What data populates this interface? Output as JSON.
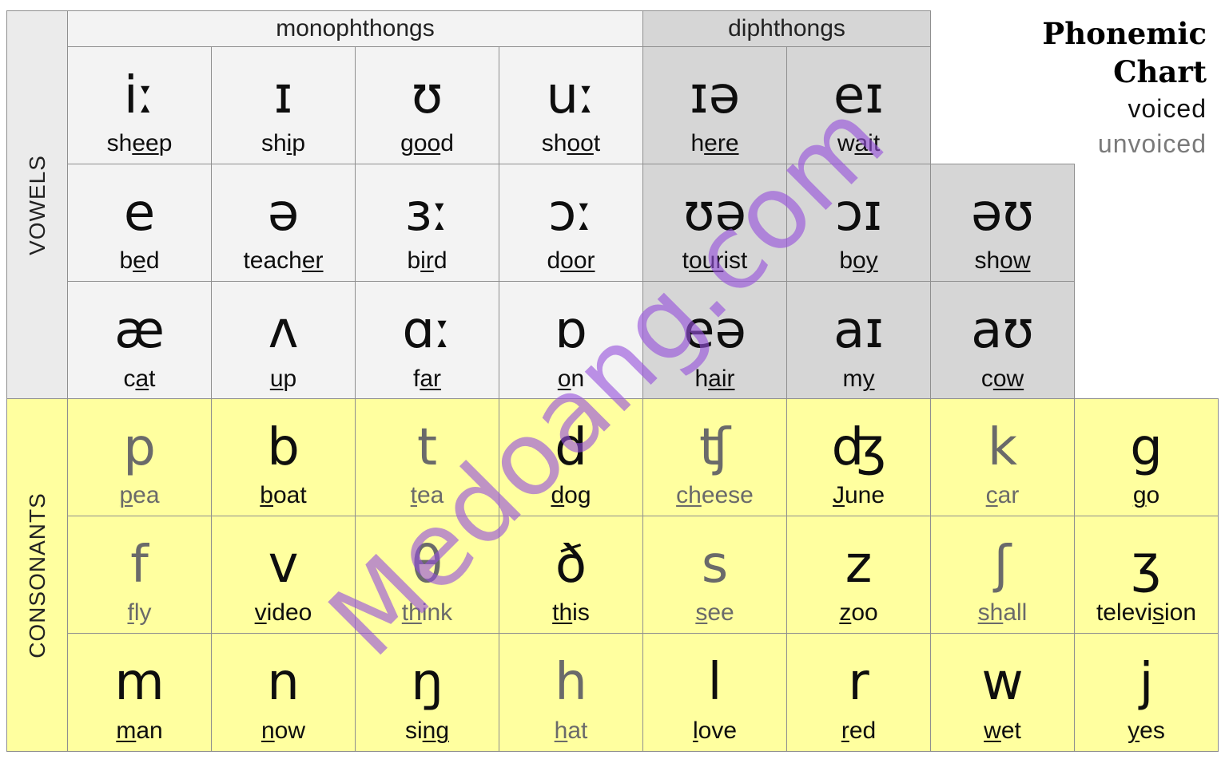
{
  "title": {
    "line1": "Phonemic",
    "line2": "Chart"
  },
  "legend": {
    "voiced": "voiced",
    "unvoiced": "unvoiced"
  },
  "headers": {
    "monophthongs": "monophthongs",
    "diphthongs": "diphthongs"
  },
  "side_labels": {
    "vowels": "VOWELS",
    "consonants": "CONSONANTS"
  },
  "watermark": "Medoang.com",
  "colors": {
    "monophthong_bg": "#f3f3f3",
    "diphthong_bg": "#d6d6d6",
    "consonant_bg": "#ffff9f",
    "voiced_text": "#0e0e0e",
    "unvoiced_text": "#6a6a6a",
    "watermark": "#9650dc"
  },
  "vowels": [
    [
      {
        "symbol": "iː",
        "pre": "sh",
        "u": "ee",
        "post": "p",
        "type": "mono"
      },
      {
        "symbol": "ɪ",
        "pre": "sh",
        "u": "i",
        "post": "p",
        "type": "mono"
      },
      {
        "symbol": "ʊ",
        "pre": "g",
        "u": "oo",
        "post": "d",
        "type": "mono"
      },
      {
        "symbol": "uː",
        "pre": "sh",
        "u": "oo",
        "post": "t",
        "type": "mono"
      },
      {
        "symbol": "ɪə",
        "pre": "h",
        "u": "ere",
        "post": "",
        "type": "diph"
      },
      {
        "symbol": "eɪ",
        "pre": "w",
        "u": "ai",
        "post": "t",
        "type": "diph"
      }
    ],
    [
      {
        "symbol": "e",
        "pre": "b",
        "u": "e",
        "post": "d",
        "type": "mono"
      },
      {
        "symbol": "ə",
        "pre": "teach",
        "u": "er",
        "post": "",
        "type": "mono"
      },
      {
        "symbol": "ɜː",
        "pre": "b",
        "u": "ir",
        "post": "d",
        "type": "mono"
      },
      {
        "symbol": "ɔː",
        "pre": "d",
        "u": "oor",
        "post": "",
        "type": "mono"
      },
      {
        "symbol": "ʊə",
        "pre": "t",
        "u": "our",
        "post": "ist",
        "type": "diph"
      },
      {
        "symbol": "ɔɪ",
        "pre": "b",
        "u": "oy",
        "post": "",
        "type": "diph"
      },
      {
        "symbol": "əʊ",
        "pre": "sh",
        "u": "ow",
        "post": "",
        "type": "diph"
      }
    ],
    [
      {
        "symbol": "æ",
        "pre": "c",
        "u": "a",
        "post": "t",
        "type": "mono"
      },
      {
        "symbol": "ʌ",
        "pre": "",
        "u": "u",
        "post": "p",
        "type": "mono"
      },
      {
        "symbol": "ɑː",
        "pre": "f",
        "u": "ar",
        "post": "",
        "type": "mono"
      },
      {
        "symbol": "ɒ",
        "pre": "",
        "u": "o",
        "post": "n",
        "type": "mono"
      },
      {
        "symbol": "eə",
        "pre": "h",
        "u": "air",
        "post": "",
        "type": "diph"
      },
      {
        "symbol": "aɪ",
        "pre": "m",
        "u": "y",
        "post": "",
        "type": "diph"
      },
      {
        "symbol": "aʊ",
        "pre": "c",
        "u": "ow",
        "post": "",
        "type": "diph"
      }
    ]
  ],
  "consonants": [
    [
      {
        "symbol": "p",
        "pre": "",
        "u": "p",
        "post": "ea",
        "voice": "unvoiced"
      },
      {
        "symbol": "b",
        "pre": "",
        "u": "b",
        "post": "oat",
        "voice": "voiced"
      },
      {
        "symbol": "t",
        "pre": "",
        "u": "t",
        "post": "ea",
        "voice": "unvoiced"
      },
      {
        "symbol": "d",
        "pre": "",
        "u": "d",
        "post": "og",
        "voice": "voiced"
      },
      {
        "symbol": "ʧ",
        "pre": "",
        "u": "ch",
        "post": "eese",
        "voice": "unvoiced"
      },
      {
        "symbol": "ʤ",
        "pre": "",
        "u": "J",
        "post": "une",
        "voice": "voiced"
      },
      {
        "symbol": "k",
        "pre": "",
        "u": "c",
        "post": "ar",
        "voice": "unvoiced"
      },
      {
        "symbol": "g",
        "pre": "",
        "u": "g",
        "post": "o",
        "voice": "voiced"
      }
    ],
    [
      {
        "symbol": "f",
        "pre": "",
        "u": "f",
        "post": "ly",
        "voice": "unvoiced"
      },
      {
        "symbol": "v",
        "pre": "",
        "u": "v",
        "post": "ideo",
        "voice": "voiced"
      },
      {
        "symbol": "θ",
        "pre": "",
        "u": "th",
        "post": "ink",
        "voice": "unvoiced"
      },
      {
        "symbol": "ð",
        "pre": "",
        "u": "th",
        "post": "is",
        "voice": "voiced"
      },
      {
        "symbol": "s",
        "pre": "",
        "u": "s",
        "post": "ee",
        "voice": "unvoiced"
      },
      {
        "symbol": "z",
        "pre": "",
        "u": "z",
        "post": "oo",
        "voice": "voiced"
      },
      {
        "symbol": "ʃ",
        "pre": "",
        "u": "sh",
        "post": "all",
        "voice": "unvoiced"
      },
      {
        "symbol": "ʒ",
        "pre": "televi",
        "u": "s",
        "post": "ion",
        "voice": "voiced"
      }
    ],
    [
      {
        "symbol": "m",
        "pre": "",
        "u": "m",
        "post": "an",
        "voice": "voiced"
      },
      {
        "symbol": "n",
        "pre": "",
        "u": "n",
        "post": "ow",
        "voice": "voiced"
      },
      {
        "symbol": "ŋ",
        "pre": "si",
        "u": "ng",
        "post": "",
        "voice": "voiced"
      },
      {
        "symbol": "h",
        "pre": "",
        "u": "h",
        "post": "at",
        "voice": "unvoiced"
      },
      {
        "symbol": "l",
        "pre": "",
        "u": "l",
        "post": "ove",
        "voice": "voiced"
      },
      {
        "symbol": "r",
        "pre": "",
        "u": "r",
        "post": "ed",
        "voice": "voiced"
      },
      {
        "symbol": "w",
        "pre": "",
        "u": "w",
        "post": "et",
        "voice": "voiced"
      },
      {
        "symbol": "j",
        "pre": "",
        "u": "y",
        "post": "es",
        "voice": "voiced"
      }
    ]
  ]
}
